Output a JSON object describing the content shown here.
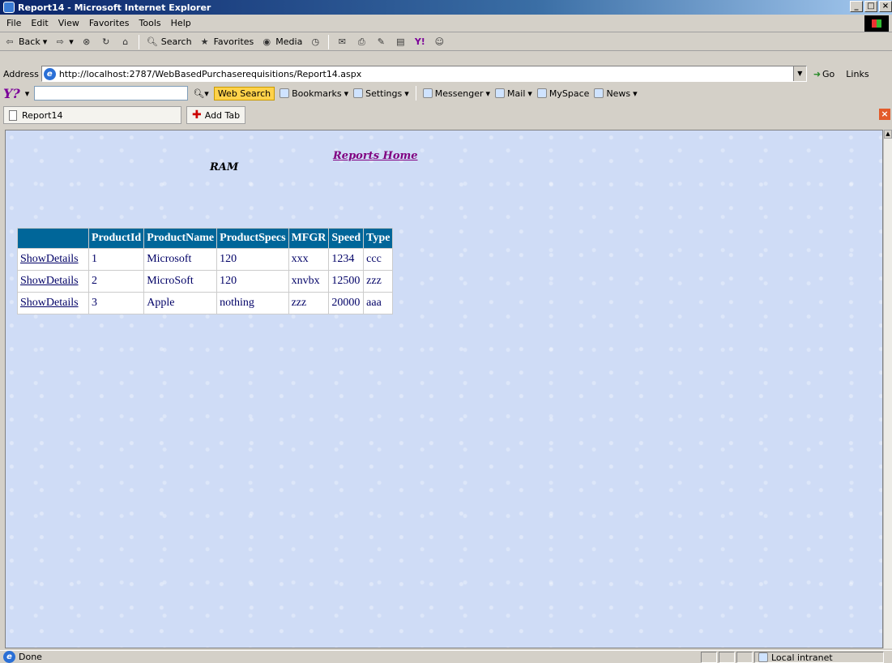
{
  "window": {
    "title": "Report14 - Microsoft Internet Explorer",
    "buttons": [
      "_",
      "×"
    ]
  },
  "menu": [
    "File",
    "Edit",
    "View",
    "Favorites",
    "Tools",
    "Help"
  ],
  "toolbar": {
    "back": "Back",
    "search": "Search",
    "favorites": "Favorites",
    "media": "Media"
  },
  "address": {
    "label": "Address",
    "url": "http://localhost:2787/WebBasedPurchaserequisitions/Report14.aspx",
    "go": "Go",
    "links": "Links"
  },
  "yahoo": {
    "logo": "Y?",
    "web_search": "Web Search",
    "bookmarks": "Bookmarks",
    "settings": "Settings",
    "messenger": "Messenger",
    "mail": "Mail",
    "myspace": "MySpace",
    "news": "News"
  },
  "tabs": {
    "current": "Report14",
    "add": "Add Tab"
  },
  "page": {
    "ram": "RAM",
    "reports_home": "Reports Home",
    "table": {
      "headers": [
        "",
        "ProductId",
        "ProductName",
        "ProductSpecs",
        "MFGR",
        "Speed",
        "Type"
      ],
      "rows": [
        {
          "link": "ShowDetails",
          "id": "1",
          "name": "Microsoft",
          "specs": "120",
          "mfgr": "xxx",
          "speed": "1234",
          "type": "ccc"
        },
        {
          "link": "ShowDetails",
          "id": "2",
          "name": "MicroSoft",
          "specs": "120",
          "mfgr": "xnvbx",
          "speed": "12500",
          "type": "zzz"
        },
        {
          "link": "ShowDetails",
          "id": "3",
          "name": "Apple",
          "specs": "nothing",
          "mfgr": "zzz",
          "speed": "20000",
          "type": "aaa"
        }
      ]
    }
  },
  "status": {
    "text": "Done",
    "zone": "Local intranet"
  }
}
